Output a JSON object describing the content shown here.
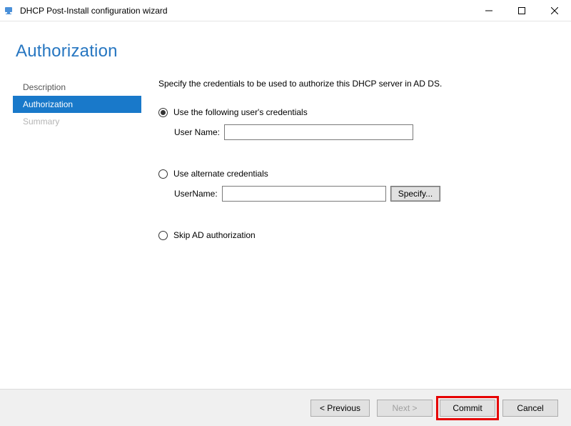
{
  "window": {
    "title": "DHCP Post-Install configuration wizard"
  },
  "header": {
    "title": "Authorization"
  },
  "sidebar": {
    "items": [
      {
        "label": "Description",
        "state": "normal"
      },
      {
        "label": "Authorization",
        "state": "active"
      },
      {
        "label": "Summary",
        "state": "disabled"
      }
    ]
  },
  "content": {
    "instruction": "Specify the credentials to be used to authorize this DHCP server in AD DS.",
    "option1": {
      "label": "Use the following user's credentials",
      "checked": true,
      "field_label": "User Name:",
      "field_value": ""
    },
    "option2": {
      "label": "Use alternate credentials",
      "checked": false,
      "field_label": "UserName:",
      "field_value": "",
      "specify_label": "Specify..."
    },
    "option3": {
      "label": "Skip AD authorization",
      "checked": false
    }
  },
  "footer": {
    "previous": "< Previous",
    "next": "Next >",
    "commit": "Commit",
    "cancel": "Cancel"
  }
}
